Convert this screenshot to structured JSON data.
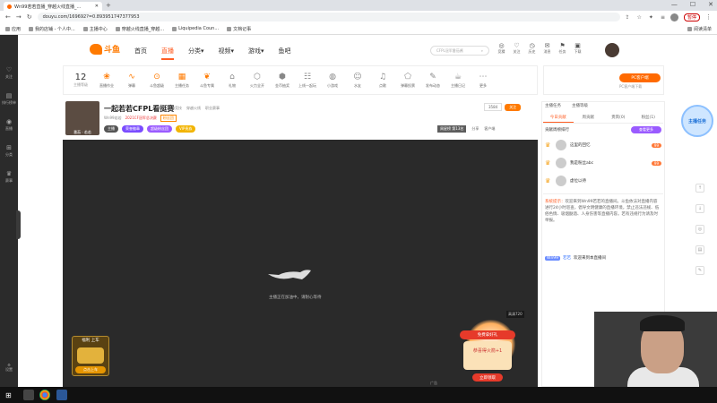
{
  "browser": {
    "tab_title": "Wn99若若直播_穿越火线直播_...",
    "new_tab": "+",
    "window_controls": [
      "—",
      "☐",
      "✕"
    ],
    "url": "douyu.com/169692?=0.893951747377953",
    "pause_label": "暂停"
  },
  "bookmarks": [
    "应用",
    "我的店铺 - 个人中...",
    "主播中心",
    "穿越火线直播_穿越...",
    "Liquipedia Coun...",
    "文档记事",
    "阅读清单"
  ],
  "rail": {
    "items": [
      {
        "glyph": "♡",
        "label": "关注"
      },
      {
        "glyph": "▤",
        "label": "排行榜单"
      },
      {
        "glyph": "◉",
        "label": "直播"
      },
      {
        "glyph": "⊞",
        "label": "分类"
      },
      {
        "glyph": "♛",
        "label": "赛事"
      }
    ],
    "bottom": {
      "glyph": "⚙",
      "label": "设置"
    }
  },
  "site": {
    "logo": "斗鱼",
    "nav": [
      "首页",
      "直播",
      "分类▾",
      "视频▾",
      "游戏▾",
      "鱼吧"
    ],
    "search_placeholder": "CFPL冠军番茄酱",
    "top_icons": [
      {
        "glyph": "◎",
        "label": "竞猜"
      },
      {
        "glyph": "♡",
        "label": "关注"
      },
      {
        "glyph": "◷",
        "label": "历史"
      },
      {
        "glyph": "✉",
        "label": "消息"
      },
      {
        "glyph": "⚑",
        "label": "任务"
      },
      {
        "glyph": "▣",
        "label": "下载"
      }
    ]
  },
  "toolbar": {
    "level": "12",
    "level_label": "主播等级",
    "items": [
      {
        "glyph": "❀",
        "label": "直播作业"
      },
      {
        "glyph": "∿",
        "label": "弹幕"
      },
      {
        "glyph": "⊙",
        "label": "斗鱼超级"
      },
      {
        "glyph": "▦",
        "label": "主播任务"
      },
      {
        "glyph": "❦",
        "label": "斗鱼专属"
      },
      {
        "glyph": "⌂",
        "label": "礼物"
      },
      {
        "glyph": "⬡",
        "label": "火力全开"
      },
      {
        "glyph": "⬢",
        "label": "金币抽奖"
      },
      {
        "glyph": "☷",
        "label": "上线一起玩"
      },
      {
        "glyph": "◍",
        "label": "小游戏"
      },
      {
        "glyph": "☺",
        "label": "水友"
      },
      {
        "glyph": "♫",
        "label": "点歌"
      },
      {
        "glyph": "⬠",
        "label": "弹幕投票"
      },
      {
        "glyph": "✎",
        "label": "发布动态"
      },
      {
        "glyph": "☕",
        "label": "主播日记"
      },
      {
        "glyph": "⋯",
        "label": "更多"
      }
    ],
    "pc_button": "PC客户端",
    "pc_download": "PC客户端下载"
  },
  "streamer": {
    "avatar_caption": "番茄 · 若若",
    "title": "一起若若CFPL看挺赛",
    "meta": [
      "举报",
      "网游竞技",
      "穿越火线",
      "职业赛事"
    ],
    "line2": [
      "Wn99若若",
      "2021CF冠军总决赛",
      "粉丝团"
    ],
    "badges": [
      {
        "text": "主播",
        "color": "#555555"
      },
      {
        "text": "荣誉徽章",
        "color": "#7a4cff"
      },
      {
        "text": "超级粉丝团",
        "color": "#9a5bff"
      },
      {
        "text": "VIP贵族",
        "color": "#f2b400"
      }
    ],
    "fans_count": "3584",
    "follow_label": "关注",
    "hour_rank": "周星榜 第13名",
    "share_label": "分享",
    "report_label": "客户端"
  },
  "player": {
    "loading_text": "主播正在加油中，请耐心等待",
    "resolution": "高清720",
    "ad_label": "广告",
    "chest_title": "福利 上车",
    "chest_button": "点击上车",
    "gift_banner": "免费拿好礼",
    "gift_text": "恭喜得火箭+1",
    "gift_button": "立即领取"
  },
  "chat": {
    "head": [
      "主播任务",
      "主播等级"
    ],
    "tabs": [
      "今日贡献",
      "周贡献",
      "贵宾(0)",
      "粉丝(1)"
    ],
    "weekly_title": "贡献周榜排行",
    "weekly_button": "查看更多",
    "ranking": [
      {
        "name": "这里的回忆",
        "level": "99"
      },
      {
        "name": "我是粉丝abc",
        "level": "99"
      },
      {
        "name": "虚位以待",
        "level": ""
      }
    ],
    "sys_label": "系统提示：",
    "sys_msg": "欢迎来到Wn99若若的直播间。斗鱼依法对直播内容进行24小时巡查，倡导文明健康的直播环境，禁止违法违规、低俗色情、吸烟酗酒、人身伤害等直播内容。若有违规行为请及时举报。",
    "welcome_badge": "Wn99",
    "welcome_name": "若若",
    "welcome_text": "欢迎来到本直播间"
  },
  "floating": {
    "ad_text": "主播任务",
    "list": [
      "↑",
      "↓",
      "◎",
      "▤",
      "✎"
    ]
  },
  "taskbar": {
    "start": "⊞"
  },
  "colors": {
    "accent": "#ff5d23",
    "orange": "#ff7a00",
    "purple": "#9a5bff"
  }
}
